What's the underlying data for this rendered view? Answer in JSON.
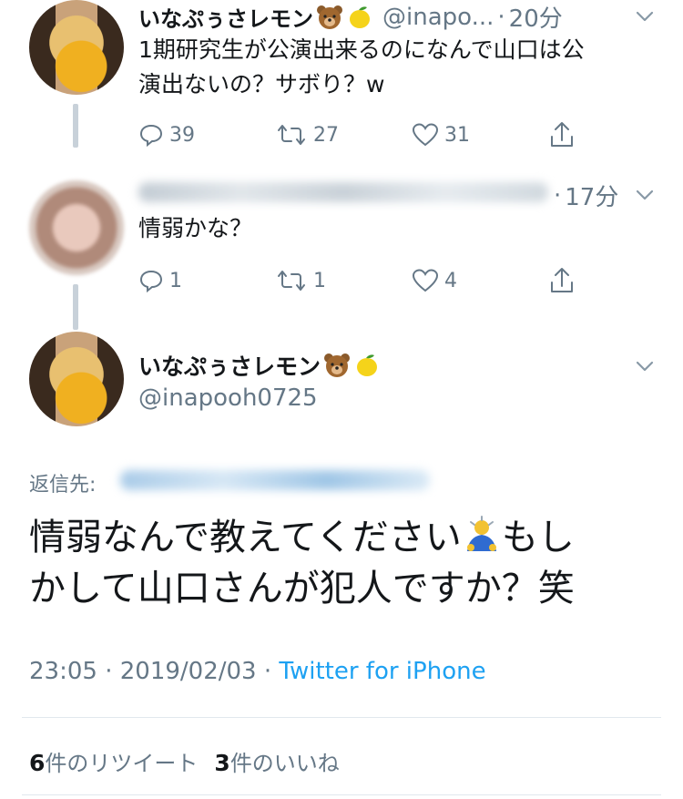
{
  "tweet1": {
    "name": "いなぷぅさレモン",
    "handle": "@inapo...",
    "dot": "·",
    "time": "20分",
    "text_line1": "1期研究生が公演出来るのになんで山口は公",
    "text_line2": "演出ないの？サボり？w",
    "replies": "39",
    "retweets": "27",
    "likes": "31"
  },
  "tweet2": {
    "dot": "·",
    "time": "17分",
    "text": "情弱かな？",
    "replies": "1",
    "retweets": "1",
    "likes": "4"
  },
  "main": {
    "name": "いなぷぅさレモン",
    "handle": "@inapooh0725",
    "reply_label": "返信先:",
    "text_line1_a": "情弱なんで教えてください",
    "text_line1_b": "もし",
    "text_line2": "かして山口さんが犯人ですか？笑",
    "time": "23:05",
    "sep1": " · ",
    "date": "2019/02/03",
    "sep2": " · ",
    "source": "Twitter for iPhone",
    "retweet_count": "6",
    "retweet_label": "件のリツイート",
    "like_count": "3",
    "like_label": "件のいいね"
  },
  "icons": {
    "emoji1": "bear-face-icon",
    "emoji2": "lemon-icon",
    "bow": "bowing-person-icon",
    "reply": "reply-icon",
    "retweet": "retweet-icon",
    "like": "heart-icon",
    "share": "share-icon",
    "caret": "chevron-down-icon"
  },
  "colors": {
    "text": "#14171a",
    "muted": "#657786",
    "link": "#1da1f2",
    "thread_line": "#c8d1d9"
  }
}
